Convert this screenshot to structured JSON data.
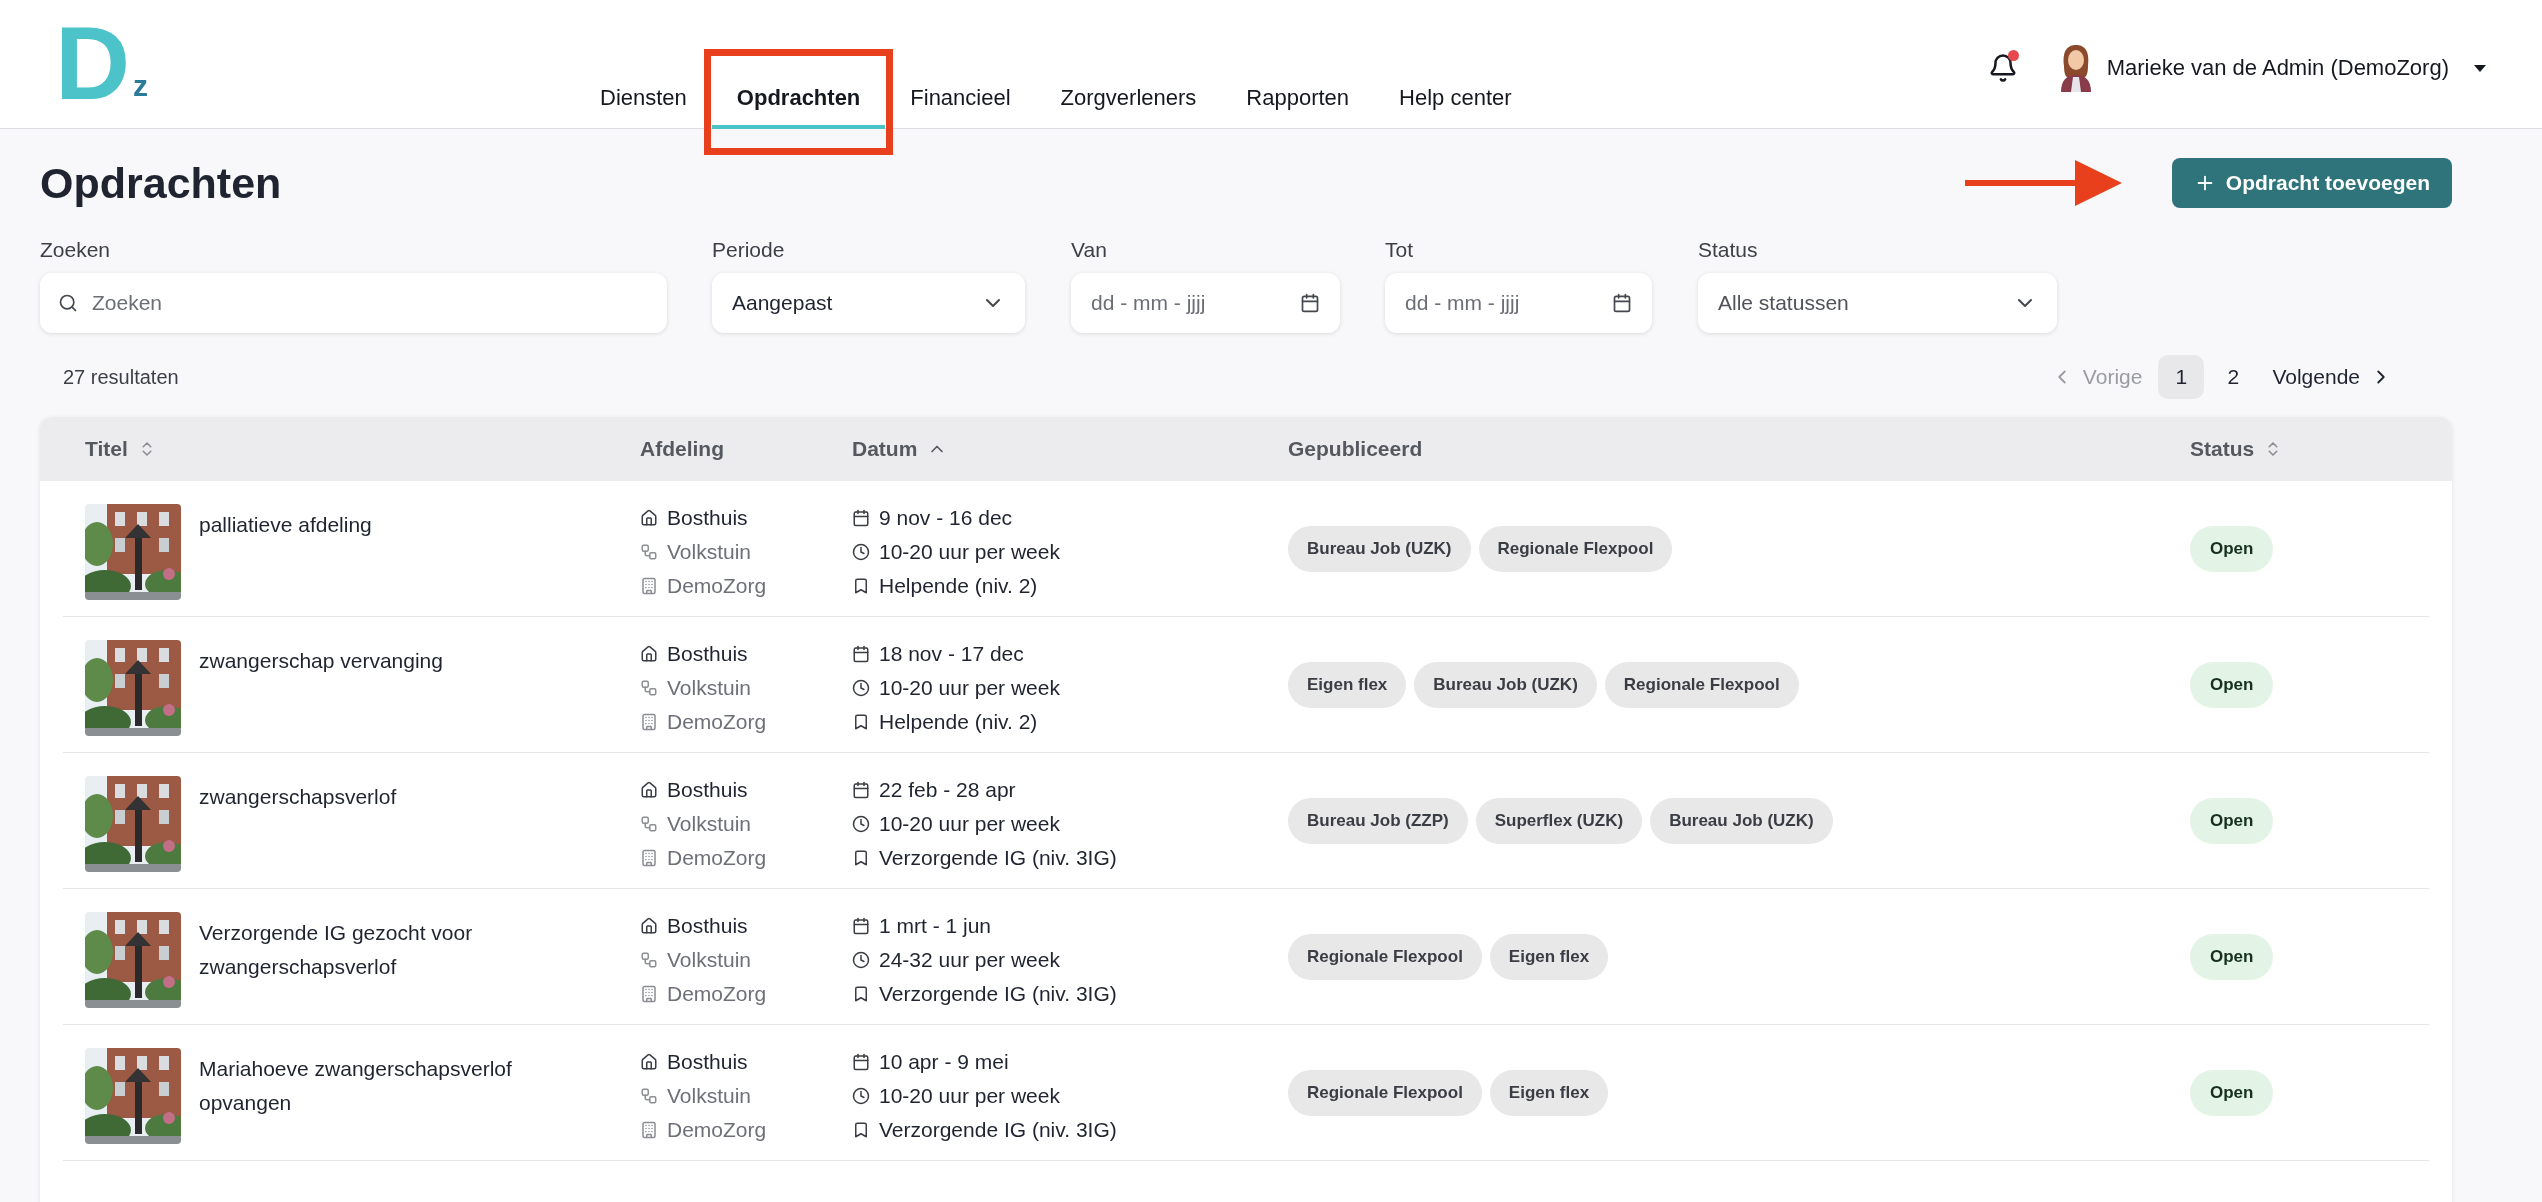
{
  "logo": {
    "main": "D",
    "sub": "z"
  },
  "nav": [
    {
      "label": "Diensten",
      "selected": false
    },
    {
      "label": "Opdrachten",
      "selected": true,
      "highlighted": true
    },
    {
      "label": "Financieel",
      "selected": false
    },
    {
      "label": "Zorgverleners",
      "selected": false
    },
    {
      "label": "Rapporten",
      "selected": false
    },
    {
      "label": "Help center",
      "selected": false
    }
  ],
  "notifications": {
    "unread": true
  },
  "user": {
    "name": "Marieke van de Admin (DemoZorg)"
  },
  "page_title": "Opdrachten",
  "add_button": {
    "label": "Opdracht toevoegen",
    "pointed_at": true
  },
  "filters": [
    {
      "kind": "search",
      "label": "Zoeken",
      "placeholder": "Zoeken"
    },
    {
      "kind": "select",
      "label": "Periode",
      "value": "Aangepast"
    },
    {
      "kind": "date",
      "label": "Van",
      "placeholder": "dd - mm - jjjj"
    },
    {
      "kind": "date",
      "label": "Tot",
      "placeholder": "dd - mm - jjjj"
    },
    {
      "kind": "select",
      "label": "Status",
      "value": "Alle statussen"
    }
  ],
  "results": "27 resultaten",
  "pagination": {
    "previous": {
      "label": "Vorige",
      "disabled": true
    },
    "pages": [
      {
        "label": "1",
        "selected": true
      },
      {
        "label": "2",
        "selected": false
      }
    ],
    "next": {
      "label": "Volgende",
      "disabled": false
    }
  },
  "table": {
    "columns": [
      {
        "label": "Titel",
        "sortable": true,
        "sorted": false
      },
      {
        "label": "Afdeling",
        "sortable": false
      },
      {
        "label": "Datum",
        "sortable": true,
        "sorted": true
      },
      {
        "label": "Gepubliceerd",
        "sortable": false
      },
      {
        "label": "Status",
        "sortable": true,
        "sorted": false
      }
    ],
    "rows": [
      {
        "image": {
          "kind": "picture"
        },
        "title": "palliatieve afdeling",
        "location": "Bosthuis",
        "department": "Volkstuin",
        "organisation": "DemoZorg",
        "date": "9 nov - 16 dec",
        "hours": "10-20 uur per week",
        "role": "Helpende (niv. 2)",
        "published": [
          "Bureau Job (UZK)",
          "Regionale Flexpool"
        ],
        "status": "Open"
      },
      {
        "image": {
          "kind": "picture"
        },
        "title": "zwangerschap vervanging",
        "location": "Bosthuis",
        "department": "Volkstuin",
        "organisation": "DemoZorg",
        "date": "18 nov - 17 dec",
        "hours": "10-20 uur per week",
        "role": "Helpende (niv. 2)",
        "published": [
          "Eigen flex",
          "Bureau Job (UZK)",
          "Regionale Flexpool"
        ],
        "status": "Open"
      },
      {
        "image": {
          "kind": "picture"
        },
        "title": "zwangerschapsverlof",
        "location": "Bosthuis",
        "department": "Volkstuin",
        "organisation": "DemoZorg",
        "date": "22 feb - 28 apr",
        "hours": "10-20 uur per week",
        "role": "Verzorgende IG (niv. 3IG)",
        "published": [
          "Bureau Job (ZZP)",
          "Superflex (UZK)",
          "Bureau Job (UZK)"
        ],
        "status": "Open"
      },
      {
        "image": {
          "kind": "picture"
        },
        "title": "Verzorgende IG gezocht voor zwangerschapsverlof",
        "location": "Bosthuis",
        "department": "Volkstuin",
        "organisation": "DemoZorg",
        "date": "1 mrt - 1 jun",
        "hours": "24-32 uur per week",
        "role": "Verzorgende IG (niv. 3IG)",
        "published": [
          "Regionale Flexpool",
          "Eigen flex"
        ],
        "status": "Open"
      },
      {
        "image": {
          "kind": "picture"
        },
        "title": "Mariahoeve zwangerschapsverlof opvangen",
        "location": "Bosthuis",
        "department": "Volkstuin",
        "organisation": "DemoZorg",
        "date": "10 apr - 9 mei",
        "hours": "10-20 uur per week",
        "role": "Verzorgende IG (niv. 3IG)",
        "published": [
          "Regionale Flexpool",
          "Eigen flex"
        ],
        "status": "Open"
      }
    ]
  }
}
